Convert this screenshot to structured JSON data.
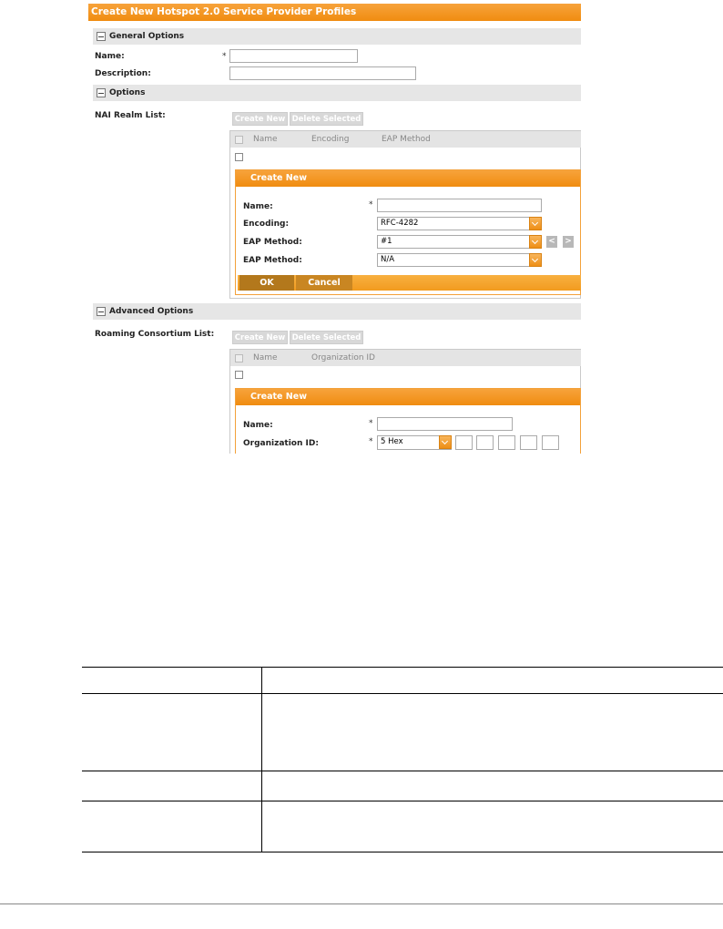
{
  "window": {
    "title": "Create New Hotspot 2.0 Service Provider Profiles"
  },
  "general_options": {
    "heading": "General Options",
    "name_label": "Name:",
    "name_required": "*",
    "name_value": "",
    "description_label": "Description:",
    "description_value": ""
  },
  "options": {
    "heading": "Options",
    "nai_realm_label": "NAI Realm List:",
    "create_new_button": "Create New",
    "delete_selected_button": "Delete Selected",
    "columns": [
      "Name",
      "Encoding",
      "EAP Method"
    ],
    "create_new_form": {
      "title": "Create New",
      "name_label": "Name:",
      "name_required": "*",
      "name_value": "",
      "encoding_label": "Encoding:",
      "encoding_value": "RFC-4282",
      "eap_method_label_1": "EAP Method:",
      "eap_method_value_1": "#1",
      "prev_button": "<",
      "next_button": ">",
      "eap_method_label_2": "EAP Method:",
      "eap_method_value_2": "N/A",
      "ok_button": "OK",
      "cancel_button": "Cancel"
    }
  },
  "advanced_options": {
    "heading": "Advanced Options",
    "roaming_label": "Roaming Consortium List:",
    "create_new_button": "Create New",
    "delete_selected_button": "Delete Selected",
    "columns": [
      "Name",
      "Organization ID"
    ],
    "create_new_form": {
      "title": "Create New",
      "name_label": "Name:",
      "name_required": "*",
      "name_value": "",
      "org_id_label": "Organization ID:",
      "org_id_required": "*",
      "org_id_value": "5 Hex"
    }
  },
  "colors": {
    "accent_orange": "#f08c10",
    "section_gray": "#e6e6e6"
  }
}
